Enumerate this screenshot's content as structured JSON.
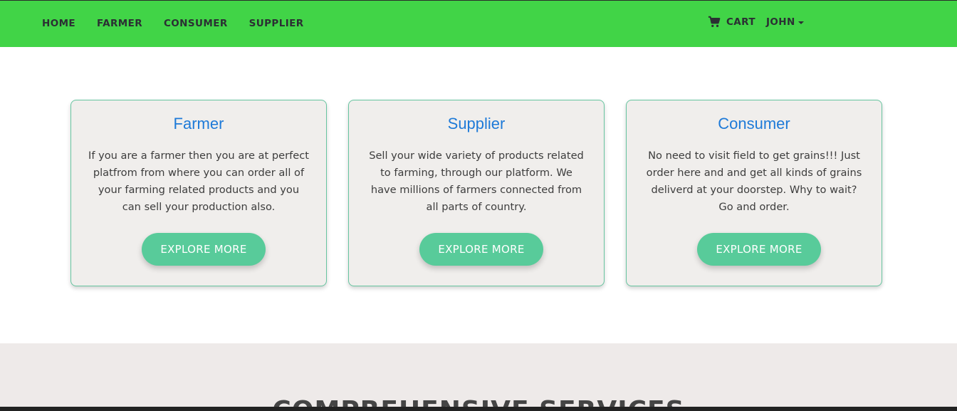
{
  "nav": {
    "links": [
      {
        "label": "HOME"
      },
      {
        "label": "FARMER"
      },
      {
        "label": "CONSUMER"
      },
      {
        "label": "SUPPLIER"
      }
    ],
    "cart_label": "CART",
    "user_label": "JOHN",
    "bar_color": "#41d447"
  },
  "cards": [
    {
      "title": "Farmer",
      "text": "If you are a farmer then you are at perfect platfrom from where you can order all of your farming related products and you can sell your production also.",
      "button": "EXPLORE MORE"
    },
    {
      "title": "Supplier",
      "text": "Sell your wide variety of products related to farming, through our platform. We have millions of farmers connected from all parts of country.",
      "button": "EXPLORE MORE"
    },
    {
      "title": "Consumer",
      "text": "No need to visit field to get grains!!! Just order here and and get all kinds of grains deliverd at your doorstep. Why to wait? Go and order.",
      "button": "EXPLORE MORE"
    }
  ],
  "services": {
    "title": "COMPREHENSIVE SERVICES"
  },
  "colors": {
    "card_title": "#1e7ad8",
    "button": "#58cb9a",
    "card_bg": "#f0eeec"
  },
  "icons": {
    "cart": "shopping-cart-icon",
    "caret": "caret-down-icon"
  }
}
